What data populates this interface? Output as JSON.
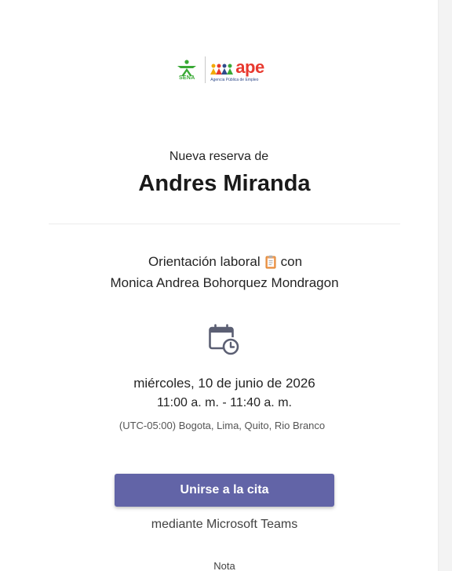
{
  "logo": {
    "sena_text": "SENA",
    "ape_word": "ape",
    "ape_subtitle": "Agencia Pública de Empleo",
    "colors": {
      "sena_green": "#39a935",
      "ape_red": "#e8392f",
      "ape_blue": "#2f4a8a"
    }
  },
  "booking": {
    "heading": "Nueva reserva de",
    "customer_name": "Andres Miranda",
    "service_name": "Orientación laboral",
    "service_icon": "clipboard-icon",
    "connector": "con",
    "staff_name": "Monica Andrea Bohorquez Mondragon",
    "calendar_icon": "calendar-clock-icon",
    "date": "miércoles, 10 de junio de 2026",
    "time": "11:00 a. m. - 11:40 a. m.",
    "timezone": "(UTC-05:00) Bogota, Lima, Quito, Rio Branco"
  },
  "join": {
    "button_label": "Unirse a la cita",
    "via_text": "mediante Microsoft Teams",
    "button_color": "#6264a7"
  },
  "note": {
    "label": "Nota"
  }
}
